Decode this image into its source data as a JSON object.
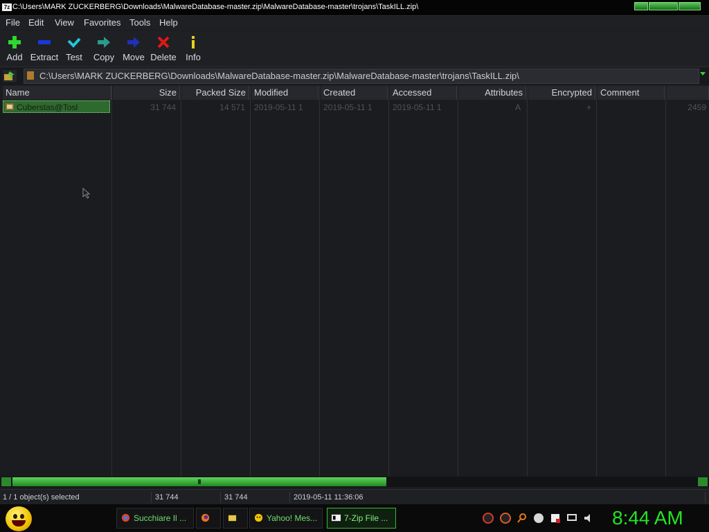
{
  "window": {
    "title": "C:\\Users\\MARK ZUCKERBERG\\Downloads\\MalwareDatabase-master.zip\\MalwareDatabase-master\\trojans\\TaskILL.zip\\",
    "app_icon": "7z"
  },
  "menu": [
    "File",
    "Edit",
    "View",
    "Favorites",
    "Tools",
    "Help"
  ],
  "toolbar": {
    "add": "Add",
    "extract": "Extract",
    "test": "Test",
    "copy": "Copy",
    "move": "Move",
    "delete": "Delete",
    "info": "Info"
  },
  "address": {
    "path": "C:\\Users\\MARK ZUCKERBERG\\Downloads\\MalwareDatabase-master.zip\\MalwareDatabase-master\\trojans\\TaskILL.zip\\"
  },
  "columns": [
    "Name",
    "Size",
    "Packed Size",
    "Modified",
    "Created",
    "Accessed",
    "Attributes",
    "Encrypted",
    "Comment",
    ""
  ],
  "rows": [
    {
      "name": "Cuberstas@Tosl",
      "size": "31 744",
      "packed": "14 571",
      "modified": "2019-05-11 1",
      "created": "2019-05-11 1",
      "accessed": "2019-05-11 1",
      "attributes": "A",
      "encrypted": "+",
      "comment": "",
      "crc": "2459"
    }
  ],
  "status": {
    "selected": "1 / 1 object(s) selected",
    "size": "31 744",
    "packed": "31 744",
    "date": "2019-05-11 11:36:06"
  },
  "taskbar": {
    "tasks": [
      {
        "label": "Succhiare Il ..."
      },
      {
        "label": ""
      },
      {
        "label": ""
      },
      {
        "label": "Yahoo! Mes..."
      },
      {
        "label": "7-Zip File ..."
      }
    ],
    "clock": "8:44 AM"
  },
  "colors": {
    "accent": "#2fbf2f",
    "clock": "#22e622",
    "background": "#1b1c1f"
  }
}
